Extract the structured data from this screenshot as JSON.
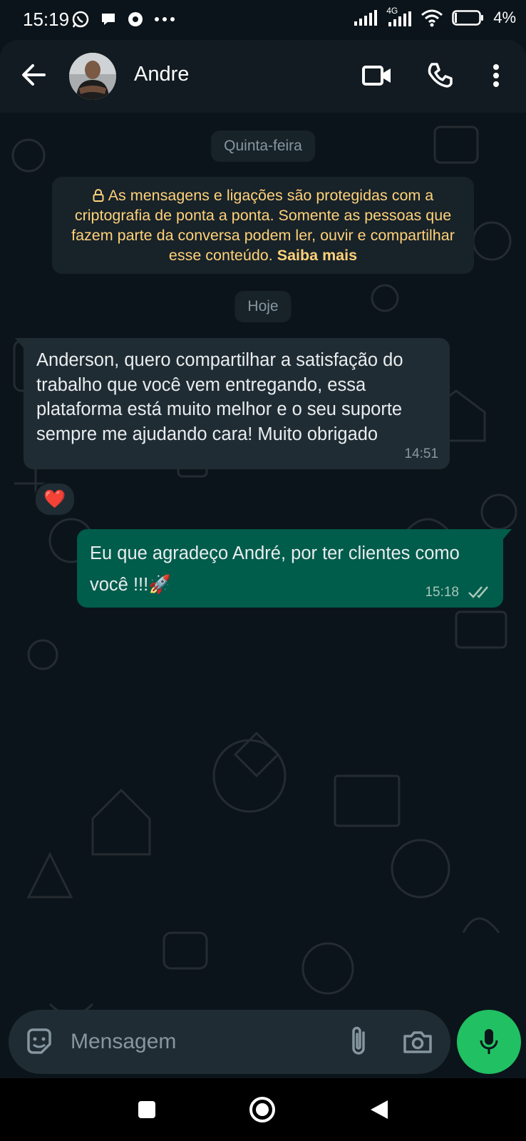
{
  "status_bar": {
    "time": "15:19",
    "network": "4G",
    "battery": "4%"
  },
  "header": {
    "contact_name": "Andre"
  },
  "chat": {
    "date_chip_1": "Quinta-feira",
    "encryption_notice": {
      "text": "As mensagens e ligações são protegidas com a criptografia de ponta a ponta. Somente as pessoas que fazem parte da conversa podem ler, ouvir e compartilhar esse conteúdo.",
      "link": "Saiba mais"
    },
    "date_chip_2": "Hoje",
    "messages": [
      {
        "direction": "incoming",
        "text": "Anderson, quero compartilhar a satisfação do trabalho que você vem entregando, essa plataforma está muito melhor e o seu suporte sempre me ajudando cara! Muito obrigado",
        "time": "14:51",
        "reaction": "❤️"
      },
      {
        "direction": "outgoing",
        "text": "Eu que agradeço André, por ter clientes como você !!!🚀",
        "time": "15:18",
        "status": "read"
      }
    ]
  },
  "composer": {
    "placeholder": "Mensagem"
  },
  "colors": {
    "background": "#0b141a",
    "incoming_bubble": "#202c33",
    "outgoing_bubble": "#005c4b",
    "accent_green": "#21c063",
    "notice_text": "#ffd279"
  }
}
